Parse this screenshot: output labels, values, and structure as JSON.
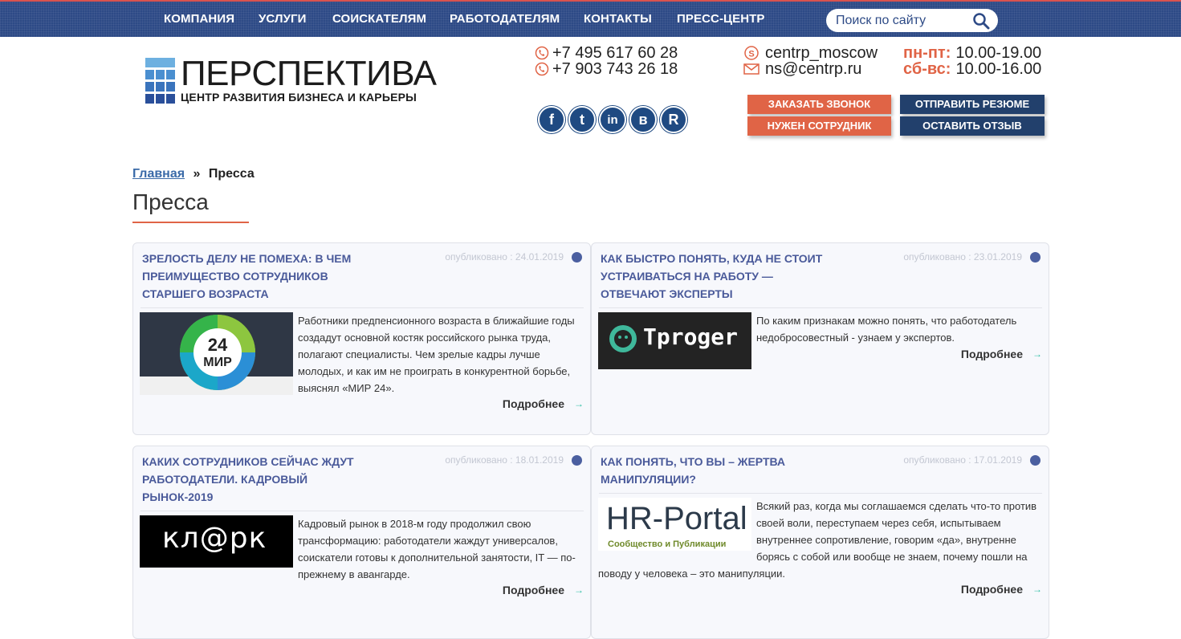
{
  "nav": [
    "КОМПАНИЯ",
    "УСЛУГИ",
    "СОИСКАТЕЛЯМ",
    "РАБОТОДАТЕЛЯМ",
    "КОНТАКТЫ",
    "ПРЕСС-ЦЕНТР"
  ],
  "search": {
    "placeholder": "Поиск по сайту"
  },
  "logo": {
    "title": "ПЕРСПЕКТИВА",
    "subtitle": "ЦЕНТР РАЗВИТИЯ БИЗНЕСА И КАРЬЕРЫ"
  },
  "phones": [
    "+7 495 617 60 28",
    "+7 903 743 26 18"
  ],
  "social": [
    "f",
    "t",
    "in",
    "в",
    "R"
  ],
  "contacts": {
    "skype": "centrp_moscow",
    "email": "ns@centrp.ru"
  },
  "hours": [
    {
      "label": "пн-пт:",
      "value": "10.00-19.00"
    },
    {
      "label": "сб-вс:",
      "value": "10.00-16.00"
    }
  ],
  "buttons": {
    "call": "ЗАКАЗАТЬ ЗВОНОК",
    "resume": "ОТПРАВИТЬ РЕЗЮМЕ",
    "employee": "НУЖЕН СОТРУДНИК",
    "review": "ОСТАВИТЬ ОТЗЫВ"
  },
  "breadcrumb": {
    "home": "Главная",
    "sep": "»",
    "current": "Пресса"
  },
  "page_title": "Пресса",
  "cards": [
    {
      "title": "ЗРЕЛОСТЬ ДЕЛУ НЕ ПОМЕХА: В ЧЕМ ПРЕИМУЩЕСТВО СОТРУДНИКОВ СТАРШЕГО ВОЗРАСТА",
      "date": "опубликовано : 24.01.2019",
      "logo_text": "24 МИР",
      "text": "Работники предпенсионного возраста в ближайшие годы создадут основной костяк российского рынка труда, полагают специалисты. Чем зрелые кадры лучше молодых, и как им не проиграть в конкурентной борьбе, выяснял «МИР 24».",
      "more": "Подробнее"
    },
    {
      "title": "КАК БЫСТРО ПОНЯТЬ, КУДА НЕ СТОИТ УСТРАИВАТЬСЯ НА РАБОТУ — ОТВЕЧАЮТ ЭКСПЕРТЫ",
      "date": "опубликовано : 23.01.2019",
      "logo_text": "Tproger",
      "text": "По каким признакам можно понять, что работодатель недобросовестный - узнаем у экспертов.",
      "more": "Подробнее"
    },
    {
      "title": "КАКИХ СОТРУДНИКОВ СЕЙЧАС ЖДУТ РАБОТОДАТЕЛИ. КАДРОВЫЙ РЫНОК-2019",
      "date": "опубликовано : 18.01.2019",
      "logo_text": "кл@рк",
      "text": "Кадровый рынок в 2018-м году продолжил свою трансформацию: работодатели жаждут универсалов, соискатели готовы к дополнительной занятости, IT — по-прежнему в авангарде.",
      "more": "Подробнее"
    },
    {
      "title": "КАК ПОНЯТЬ, ЧТО ВЫ – ЖЕРТВА МАНИПУЛЯЦИИ?",
      "date": "опубликовано : 17.01.2019",
      "logo_text": "HR-Portal",
      "logo_sub": "Сообщество и Публикации",
      "text": "Всякий раз, когда мы соглашаемся сделать что-то против своей воли, переступаем через себя, испытываем внутреннее сопротивление, говорим «да», внутренне борясь с собой или вообще не знаем, почему пошли на поводу у человека – это манипуляции.",
      "more": "Подробнее"
    }
  ],
  "colors": {
    "nav_bg": "#2d4a86",
    "accent": "#e06446",
    "dark_btn": "#22406c",
    "card_title": "#4a5a9a"
  }
}
